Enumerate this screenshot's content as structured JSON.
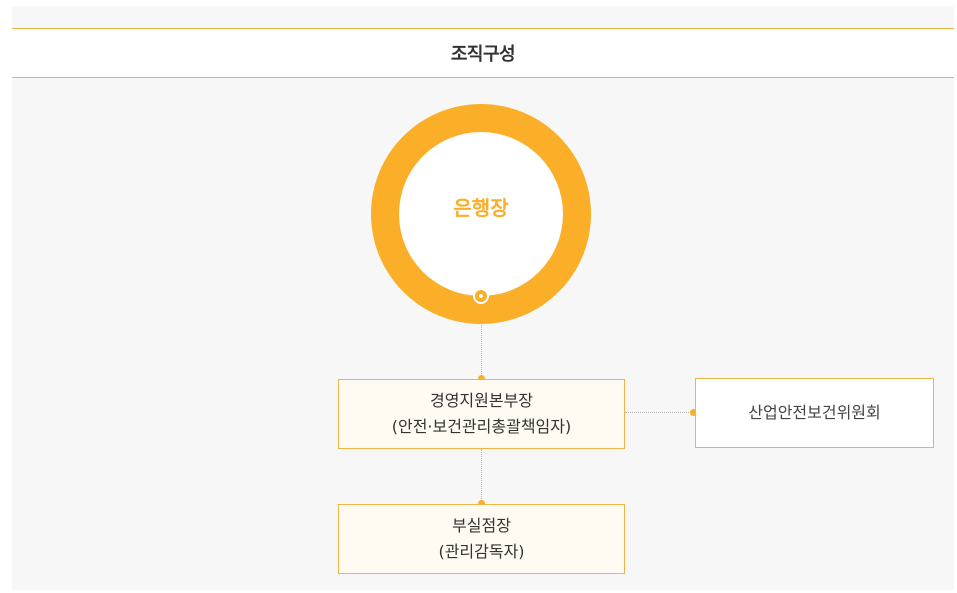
{
  "title": "조직구성",
  "nodes": {
    "head": {
      "label": "은행장"
    },
    "director": {
      "line1": "경영지원본부장",
      "line2": "(안전·보건관리총괄책임자)"
    },
    "committee": {
      "label": "산업안전보건위원회"
    },
    "manager": {
      "line1": "부실점장",
      "line2": "(관리감독자)"
    }
  },
  "colors": {
    "accent": "#fbae28",
    "border": "#f0b545",
    "box_fill": "#fffaf2",
    "background": "#f6f7f6"
  }
}
